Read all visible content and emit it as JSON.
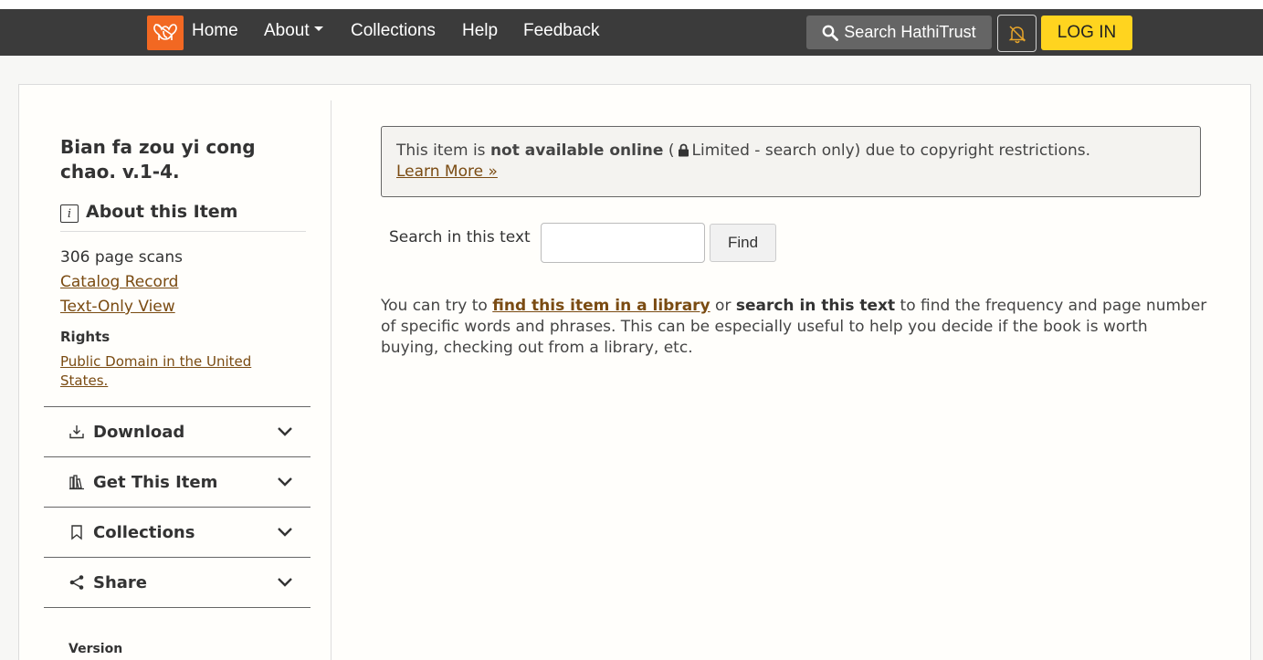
{
  "navbar": {
    "logo_icon": "hathitrust-elephant-icon",
    "home": "Home",
    "about": "About",
    "collections": "Collections",
    "help": "Help",
    "feedback": "Feedback",
    "search_label": "Search HathiTrust",
    "search_icon": "search-icon",
    "notifications_icon": "bell-slash-icon",
    "login_label": "LOG IN"
  },
  "sidebar": {
    "title": "Bian fa zou yi cong chao. v.1-4.",
    "about_heading": "About this Item",
    "page_scans": "306 page scans",
    "catalog_record": "Catalog Record",
    "text_only": "Text-Only View",
    "rights_label": "Rights",
    "rights_value": "Public Domain in the United States.",
    "accordion": [
      {
        "label": "Download",
        "icon": "download-icon"
      },
      {
        "label": "Get This Item",
        "icon": "library-books-icon"
      },
      {
        "label": "Collections",
        "icon": "bookmark-icon"
      },
      {
        "label": "Share",
        "icon": "share-icon"
      }
    ],
    "version_label": "Version"
  },
  "main": {
    "alert": {
      "prefix": "This item is ",
      "strong": "not available online",
      "paren_open": " (",
      "restriction": "Limited - search only)",
      "suffix": " due to copyright restrictions.",
      "learn_more": "Learn More »"
    },
    "search": {
      "label": "Search in this text",
      "value": "",
      "find_label": "Find"
    },
    "help": {
      "part1": "You can try to ",
      "link": "find this item in a library",
      "part2": " or ",
      "bold": "search in this text",
      "part3": " to find the frequency and page number of specific words and phrases. This can be especially useful to help you decide if the book is worth buying, checking out from a library, etc."
    }
  },
  "colors": {
    "navbar_bg": "#3b3b3b",
    "logo_orange": "#f26822",
    "login_yellow": "#ffd41f",
    "link_brown": "#7a4b12"
  }
}
